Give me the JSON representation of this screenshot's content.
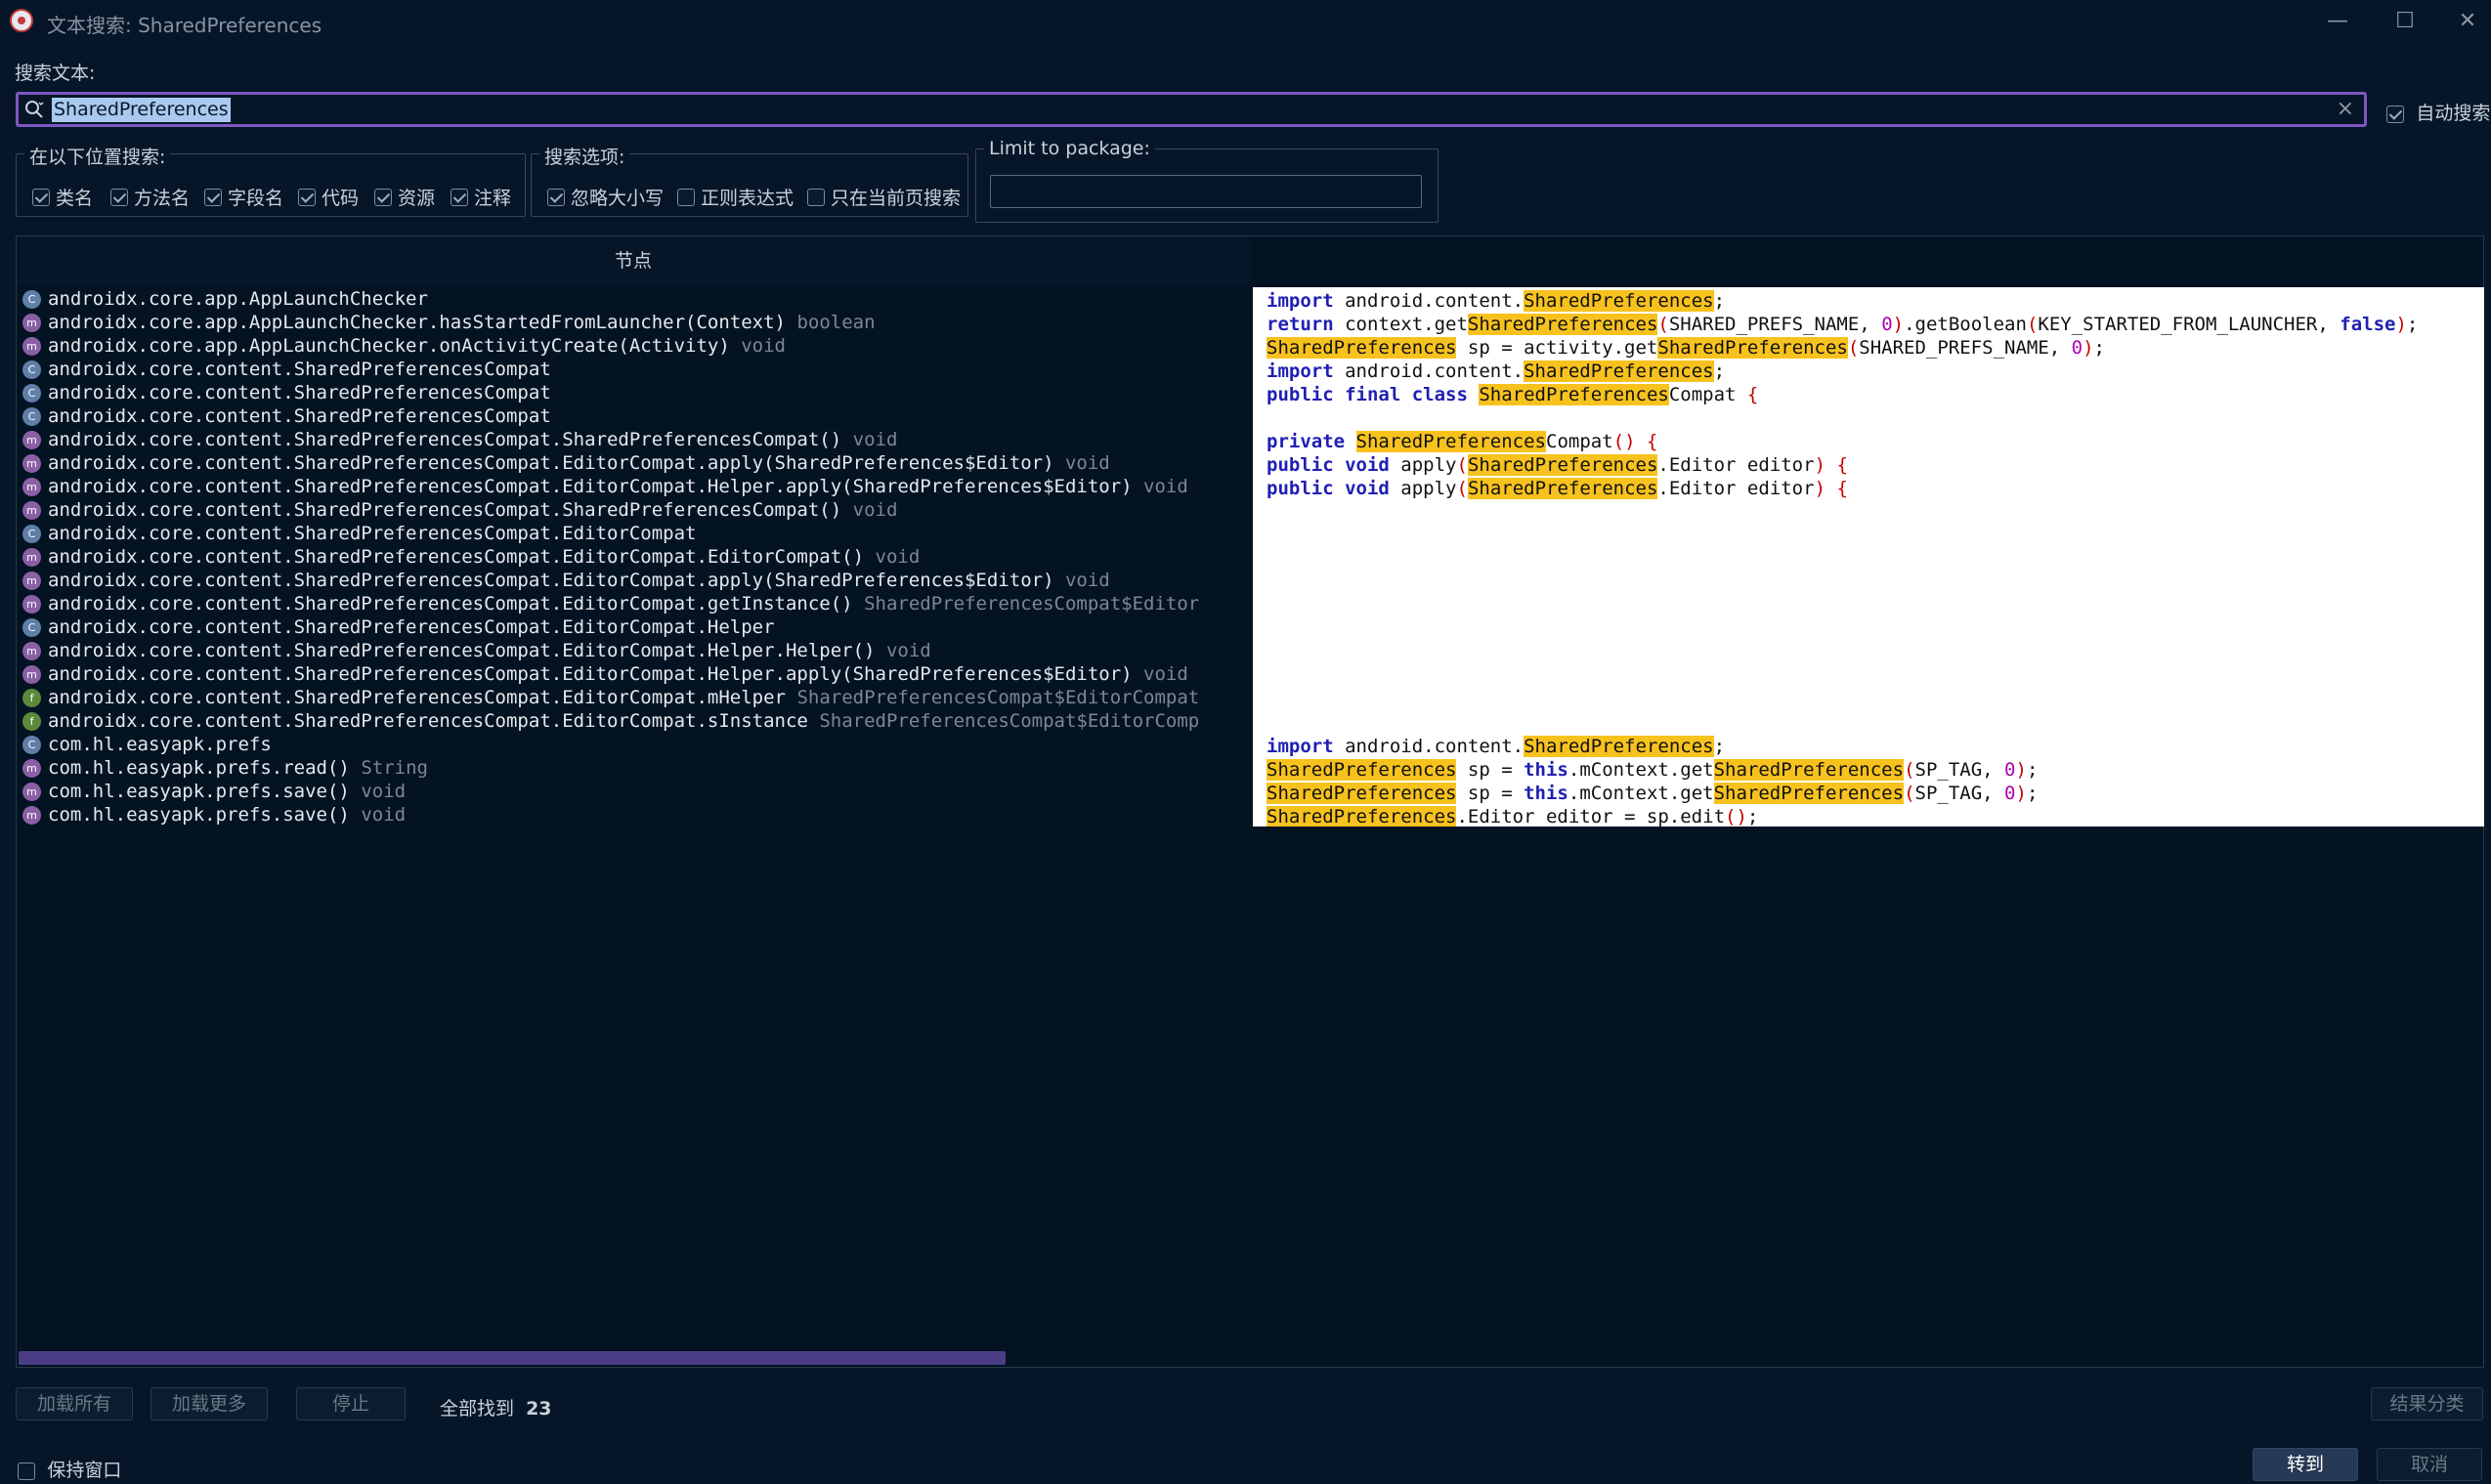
{
  "window": {
    "title": "文本搜索: SharedPreferences",
    "minimize": "—",
    "maximize": "☐",
    "close": "✕"
  },
  "search": {
    "label": "搜索文本:",
    "value": "SharedPreferences",
    "clear": "×",
    "auto_label": "自动搜索",
    "auto_checked": true
  },
  "search_in": {
    "legend": "在以下位置搜索:",
    "options": [
      {
        "label": "类名",
        "checked": true
      },
      {
        "label": "方法名",
        "checked": true
      },
      {
        "label": "字段名",
        "checked": true
      },
      {
        "label": "代码",
        "checked": true
      },
      {
        "label": "资源",
        "checked": true
      },
      {
        "label": "注释",
        "checked": true
      }
    ]
  },
  "search_opts": {
    "legend": "搜索选项:",
    "options": [
      {
        "label": "忽略大小写",
        "checked": true
      },
      {
        "label": "正则表达式",
        "checked": false
      },
      {
        "label": "只在当前页搜索",
        "checked": false
      }
    ]
  },
  "limit": {
    "legend": "Limit to package:",
    "value": ""
  },
  "results": {
    "header": "节点",
    "rows": [
      {
        "icon": "c",
        "name": "androidx.core.app.AppLaunchChecker",
        "type": ""
      },
      {
        "icon": "m",
        "name": "androidx.core.app.AppLaunchChecker.hasStartedFromLauncher(Context)",
        "type": "boolean"
      },
      {
        "icon": "m",
        "name": "androidx.core.app.AppLaunchChecker.onActivityCreate(Activity)",
        "type": "void"
      },
      {
        "icon": "c",
        "name": "androidx.core.content.SharedPreferencesCompat",
        "type": ""
      },
      {
        "icon": "c",
        "name": "androidx.core.content.SharedPreferencesCompat",
        "type": ""
      },
      {
        "icon": "c",
        "name": "androidx.core.content.SharedPreferencesCompat",
        "type": ""
      },
      {
        "icon": "m",
        "name": "androidx.core.content.SharedPreferencesCompat.SharedPreferencesCompat()",
        "type": "void"
      },
      {
        "icon": "m",
        "name": "androidx.core.content.SharedPreferencesCompat.EditorCompat.apply(SharedPreferences$Editor)",
        "type": "void"
      },
      {
        "icon": "m",
        "name": "androidx.core.content.SharedPreferencesCompat.EditorCompat.Helper.apply(SharedPreferences$Editor)",
        "type": "void"
      },
      {
        "icon": "m",
        "name": "androidx.core.content.SharedPreferencesCompat.SharedPreferencesCompat()",
        "type": "void"
      },
      {
        "icon": "c",
        "name": "androidx.core.content.SharedPreferencesCompat.EditorCompat",
        "type": ""
      },
      {
        "icon": "m",
        "name": "androidx.core.content.SharedPreferencesCompat.EditorCompat.EditorCompat()",
        "type": "void"
      },
      {
        "icon": "m",
        "name": "androidx.core.content.SharedPreferencesCompat.EditorCompat.apply(SharedPreferences$Editor)",
        "type": "void"
      },
      {
        "icon": "m",
        "name": "androidx.core.content.SharedPreferencesCompat.EditorCompat.getInstance()",
        "type": "SharedPreferencesCompat$Editor"
      },
      {
        "icon": "c",
        "name": "androidx.core.content.SharedPreferencesCompat.EditorCompat.Helper",
        "type": ""
      },
      {
        "icon": "m",
        "name": "androidx.core.content.SharedPreferencesCompat.EditorCompat.Helper.Helper()",
        "type": "void"
      },
      {
        "icon": "m",
        "name": "androidx.core.content.SharedPreferencesCompat.EditorCompat.Helper.apply(SharedPreferences$Editor)",
        "type": "void"
      },
      {
        "icon": "f",
        "name": "androidx.core.content.SharedPreferencesCompat.EditorCompat.mHelper",
        "type": "SharedPreferencesCompat$EditorCompat"
      },
      {
        "icon": "f",
        "name": "androidx.core.content.SharedPreferencesCompat.EditorCompat.sInstance",
        "type": "SharedPreferencesCompat$EditorComp"
      },
      {
        "icon": "c",
        "name": "com.hl.easyapk.prefs",
        "type": ""
      },
      {
        "icon": "m",
        "name": "com.hl.easyapk.prefs.read()",
        "type": "String"
      },
      {
        "icon": "m",
        "name": "com.hl.easyapk.prefs.save()",
        "type": "void"
      },
      {
        "icon": "m",
        "name": "com.hl.easyapk.prefs.save()",
        "type": "void"
      }
    ],
    "code": [
      [
        [
          "k",
          "import"
        ],
        [
          "t",
          " android.content."
        ],
        [
          "h",
          "SharedPreferences"
        ],
        [
          "t",
          ";"
        ]
      ],
      [
        [
          "k",
          "return"
        ],
        [
          "t",
          " context.get"
        ],
        [
          "h",
          "SharedPreferences"
        ],
        [
          "p",
          "("
        ],
        [
          "t",
          "SHARED_PREFS_NAME, "
        ],
        [
          "n",
          "0"
        ],
        [
          "p",
          ")"
        ],
        [
          "t",
          ".getBoolean"
        ],
        [
          "p",
          "("
        ],
        [
          "t",
          "KEY_STARTED_FROM_LAUNCHER, "
        ],
        [
          "k",
          "false"
        ],
        [
          "p",
          ")"
        ],
        [
          "t",
          ";"
        ]
      ],
      [
        [
          "h",
          "SharedPreferences"
        ],
        [
          "t",
          " sp = activity.get"
        ],
        [
          "h",
          "SharedPreferences"
        ],
        [
          "p",
          "("
        ],
        [
          "t",
          "SHARED_PREFS_NAME, "
        ],
        [
          "n",
          "0"
        ],
        [
          "p",
          ")"
        ],
        [
          "t",
          ";"
        ]
      ],
      [
        [
          "k",
          "import"
        ],
        [
          "t",
          " android.content."
        ],
        [
          "h",
          "SharedPreferences"
        ],
        [
          "t",
          ";"
        ]
      ],
      [
        [
          "k",
          "public final class"
        ],
        [
          "t",
          " "
        ],
        [
          "h",
          "SharedPreferences"
        ],
        [
          "t",
          "Compat "
        ],
        [
          "p",
          "{"
        ]
      ],
      [],
      [
        [
          "k",
          "private"
        ],
        [
          "t",
          " "
        ],
        [
          "h",
          "SharedPreferences"
        ],
        [
          "t",
          "Compat"
        ],
        [
          "p",
          "()"
        ],
        [
          "t",
          " "
        ],
        [
          "p",
          "{"
        ]
      ],
      [
        [
          "k",
          "public void"
        ],
        [
          "t",
          " apply"
        ],
        [
          "p",
          "("
        ],
        [
          "h",
          "SharedPreferences"
        ],
        [
          "t",
          ".Editor editor"
        ],
        [
          "p",
          ")"
        ],
        [
          "t",
          " "
        ],
        [
          "p",
          "{"
        ]
      ],
      [
        [
          "k",
          "public void"
        ],
        [
          "t",
          " apply"
        ],
        [
          "p",
          "("
        ],
        [
          "h",
          "SharedPreferences"
        ],
        [
          "t",
          ".Editor editor"
        ],
        [
          "p",
          ")"
        ],
        [
          "t",
          " "
        ],
        [
          "p",
          "{"
        ]
      ],
      [],
      [],
      [],
      [],
      [],
      [],
      [],
      [],
      [],
      [],
      [
        [
          "k",
          "import"
        ],
        [
          "t",
          " android.content."
        ],
        [
          "h",
          "SharedPreferences"
        ],
        [
          "t",
          ";"
        ]
      ],
      [
        [
          "h",
          "SharedPreferences"
        ],
        [
          "t",
          " sp = "
        ],
        [
          "k",
          "this"
        ],
        [
          "t",
          ".mContext.get"
        ],
        [
          "h",
          "SharedPreferences"
        ],
        [
          "p",
          "("
        ],
        [
          "t",
          "SP_TAG, "
        ],
        [
          "n",
          "0"
        ],
        [
          "p",
          ")"
        ],
        [
          "t",
          ";"
        ]
      ],
      [
        [
          "h",
          "SharedPreferences"
        ],
        [
          "t",
          " sp = "
        ],
        [
          "k",
          "this"
        ],
        [
          "t",
          ".mContext.get"
        ],
        [
          "h",
          "SharedPreferences"
        ],
        [
          "p",
          "("
        ],
        [
          "t",
          "SP_TAG, "
        ],
        [
          "n",
          "0"
        ],
        [
          "p",
          ")"
        ],
        [
          "t",
          ";"
        ]
      ],
      [
        [
          "h",
          "SharedPreferences"
        ],
        [
          "t",
          ".Editor editor = sp.edit"
        ],
        [
          "p",
          "()"
        ],
        [
          "t",
          ";"
        ]
      ]
    ]
  },
  "footer": {
    "load_all": "加载所有",
    "load_more": "加载更多",
    "stop": "停止",
    "found_label": "全部找到",
    "found_count": "23",
    "group": "结果分类",
    "keep_label": "保持窗口",
    "keep_checked": false,
    "goto": "转到",
    "cancel": "取消"
  }
}
